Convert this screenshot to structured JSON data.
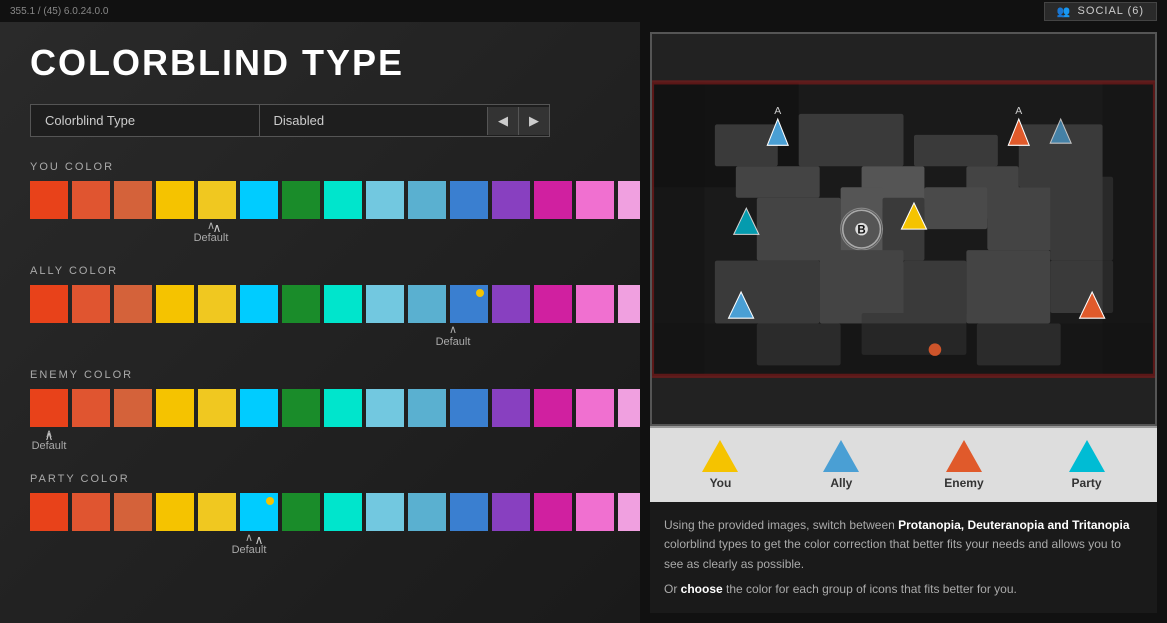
{
  "topbar": {
    "version": "355.1 / (45) 6.0.24.0.0",
    "social_label": "SOCIAL (6)",
    "game_info": "45"
  },
  "page": {
    "title": "COLORBLIND TYPE",
    "selector": {
      "label": "Colorblind Type",
      "value": "Disabled"
    }
  },
  "sections": [
    {
      "id": "you",
      "label": "YOU COLOR",
      "selected_index": 4,
      "default_index": 4,
      "colors": [
        "#e8421a",
        "#e05530",
        "#d4623a",
        "#f5c300",
        "#f0c820",
        "#00ccff",
        "#1a8c2a",
        "#00e5cc",
        "#72c8e0",
        "#5ab0d0",
        "#3a7fd0",
        "#8840c0",
        "#d020a0",
        "#f070d0",
        "#f0a0e0"
      ]
    },
    {
      "id": "ally",
      "label": "ALLY COLOR",
      "selected_index": 11,
      "default_index": 11,
      "colors": [
        "#e8421a",
        "#e05530",
        "#d4623a",
        "#f5c300",
        "#f0c820",
        "#00ccff",
        "#1a8c2a",
        "#00e5cc",
        "#72c8e0",
        "#5ab0d0",
        "#3a7fd0",
        "#8840c0",
        "#d020a0",
        "#f070d0",
        "#f0a0e0"
      ]
    },
    {
      "id": "enemy",
      "label": "ENEMY COLOR",
      "selected_index": 0,
      "default_index": 0,
      "colors": [
        "#e8421a",
        "#e05530",
        "#d4623a",
        "#f5c300",
        "#f0c820",
        "#00ccff",
        "#1a8c2a",
        "#00e5cc",
        "#72c8e0",
        "#5ab0d0",
        "#3a7fd0",
        "#8840c0",
        "#d020a0",
        "#f070d0",
        "#f0a0e0"
      ]
    },
    {
      "id": "party",
      "label": "PARTY COLOR",
      "selected_index": 5,
      "default_index": 5,
      "colors": [
        "#e8421a",
        "#e05530",
        "#d4623a",
        "#f5c300",
        "#f0c820",
        "#00ccff",
        "#1a8c2a",
        "#00e5cc",
        "#72c8e0",
        "#5ab0d0",
        "#3a7fd0",
        "#8840c0",
        "#d020a0",
        "#f070d0",
        "#f0a0e0"
      ]
    }
  ],
  "legend": {
    "items": [
      {
        "id": "you",
        "label": "You",
        "color": "#f5c300"
      },
      {
        "id": "ally",
        "label": "Ally",
        "color": "#4a9fd4"
      },
      {
        "id": "enemy",
        "label": "Enemy",
        "color": "#e05a2b"
      },
      {
        "id": "party",
        "label": "Party",
        "color": "#00bcd4"
      }
    ]
  },
  "info": {
    "text1": "Using the provided images, switch between ",
    "bold1": "Protanopia, Deuteranopia and Tritanopia",
    "text2": " colorblind types to get the color correction that better fits your needs and allows you to see as clearly as possible.",
    "text3": "Or ",
    "bold2": "choose",
    "text4": " the color for each group of icons that fits better for you."
  },
  "labels": {
    "default": "Default",
    "prev_arrow": "◀",
    "next_arrow": "▶"
  }
}
